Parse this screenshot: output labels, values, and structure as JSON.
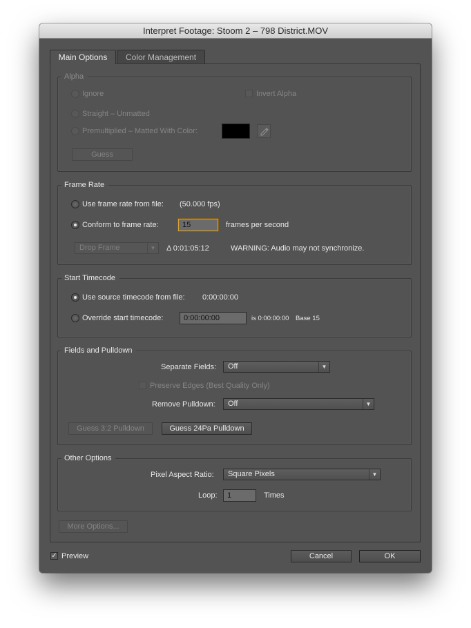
{
  "window": {
    "title": "Interpret Footage: Stoom 2 – 798 District.MOV"
  },
  "tabs": [
    {
      "label": "Main Options",
      "active": true
    },
    {
      "label": "Color Management",
      "active": false
    }
  ],
  "alpha": {
    "legend": "Alpha",
    "ignore_label": "Ignore",
    "invert_label": "Invert Alpha",
    "straight_label": "Straight – Unmatted",
    "premult_label": "Premultiplied – Matted With Color:",
    "matte_color": "#000000",
    "guess_label": "Guess"
  },
  "frame_rate": {
    "legend": "Frame Rate",
    "use_file_label": "Use frame rate from file:",
    "file_fps": "(50.000 fps)",
    "conform_label": "Conform to frame rate:",
    "conform_value": "15",
    "fps_unit": "frames per second",
    "drop_frame_option": "Drop Frame",
    "duration": "Δ 0:01:05:12",
    "warning": "WARNING: Audio may not synchronize."
  },
  "start_timecode": {
    "legend": "Start Timecode",
    "use_source_label": "Use source timecode from file:",
    "source_value": "0:00:00:00",
    "override_label": "Override start timecode:",
    "override_value": "0:00:00:00",
    "is_text": "is 0:00:00:00",
    "base_text": "Base 15"
  },
  "fields_pulldown": {
    "legend": "Fields and Pulldown",
    "separate_label": "Separate Fields:",
    "separate_value": "Off",
    "preserve_label": "Preserve Edges (Best Quality Only)",
    "remove_label": "Remove Pulldown:",
    "remove_value": "Off",
    "guess32_label": "Guess 3:2 Pulldown",
    "guess24_label": "Guess 24Pa Pulldown"
  },
  "other_options": {
    "legend": "Other Options",
    "par_label": "Pixel Aspect Ratio:",
    "par_value": "Square Pixels",
    "loop_label": "Loop:",
    "loop_value": "1",
    "loop_unit": "Times"
  },
  "more_options_label": "More Options...",
  "footer": {
    "preview_label": "Preview",
    "preview_checked": true,
    "cancel_label": "Cancel",
    "ok_label": "OK"
  },
  "icons": {
    "eyedropper": "eyedropper-icon",
    "dropdown": "chevron-down-icon",
    "check": "checkmark-icon"
  }
}
